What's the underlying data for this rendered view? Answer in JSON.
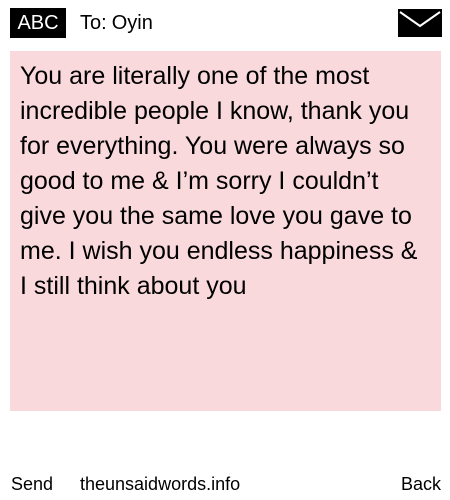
{
  "header": {
    "input_mode": "ABC",
    "to_label": "To:",
    "recipient": "Oyin",
    "mail_icon": "envelope-icon"
  },
  "message": {
    "text": "You are literally one of the most incredible people I know, thank you for everything. You were always so good to me & I’m sorry I couldn’t give you the same love you gave to me. I wish you endless happiness & I still think about you"
  },
  "footer": {
    "send_label": "Send",
    "site_label": "theunsaidwords.info",
    "back_label": "Back"
  },
  "colors": {
    "message_background": "#f9d9dc",
    "badge_background": "#000000",
    "badge_text": "#ffffff"
  }
}
